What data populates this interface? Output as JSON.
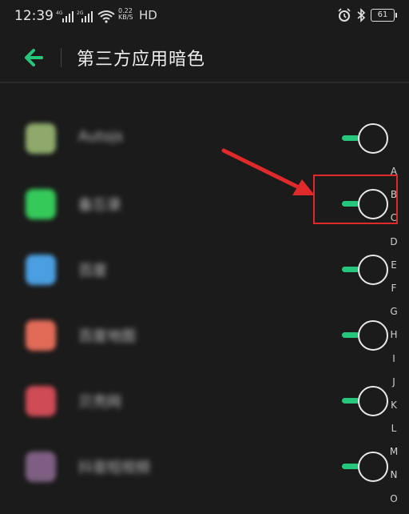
{
  "status_bar": {
    "time": "12:39",
    "net1": "4G",
    "net2": "2G",
    "net_speed_value": "0.22",
    "net_speed_unit": "KB/S",
    "hd": "HD",
    "battery": "61"
  },
  "header": {
    "title": "第三方应用暗色",
    "accent_color": "#25c77d"
  },
  "apps": [
    {
      "name": "Autojs",
      "icon_color": "#8ea96b",
      "enabled": true
    },
    {
      "name": "备忘录",
      "icon_color": "#35c95a",
      "enabled": true
    },
    {
      "name": "百度",
      "icon_color": "#4a9fe0",
      "enabled": true
    },
    {
      "name": "百度地图",
      "icon_color": "#e26b58",
      "enabled": true
    },
    {
      "name": "贝壳网",
      "icon_color": "#cf4b56",
      "enabled": true
    },
    {
      "name": "抖音短视频",
      "icon_color": "#7d5f82",
      "enabled": true
    }
  ],
  "index_letters": [
    "A",
    "B",
    "C",
    "D",
    "E",
    "F",
    "G",
    "H",
    "I",
    "J",
    "K",
    "L",
    "M",
    "N",
    "O"
  ],
  "annotation_color": "#e0292b"
}
